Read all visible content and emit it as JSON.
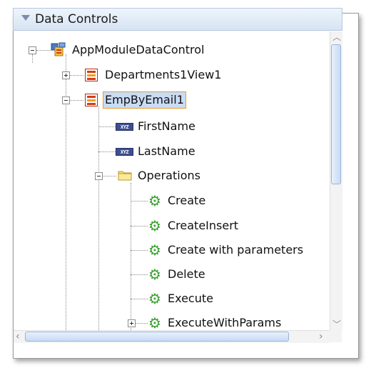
{
  "panel": {
    "title": "Data Controls"
  },
  "tree": {
    "root": {
      "label": "AppModuleDataControl",
      "icon": "app-module-icon"
    },
    "departments": {
      "label": "Departments1View1",
      "icon": "collection-icon"
    },
    "emp": {
      "label": "EmpByEmail1",
      "icon": "collection-icon"
    },
    "first_name": {
      "label": "FirstName",
      "icon": "attribute-icon",
      "badge": "XYZ"
    },
    "last_name": {
      "label": "LastName",
      "icon": "attribute-icon",
      "badge": "XYZ"
    },
    "operations": {
      "label": "Operations",
      "icon": "folder-icon"
    },
    "ops": [
      {
        "label": "Create",
        "icon": "gear-icon"
      },
      {
        "label": "CreateInsert",
        "icon": "gear-icon"
      },
      {
        "label": "Create with parameters",
        "icon": "gear-icon"
      },
      {
        "label": "Delete",
        "icon": "gear-icon"
      },
      {
        "label": "Execute",
        "icon": "gear-icon"
      },
      {
        "label": "ExecuteWithParams",
        "icon": "gear-icon"
      }
    ]
  }
}
